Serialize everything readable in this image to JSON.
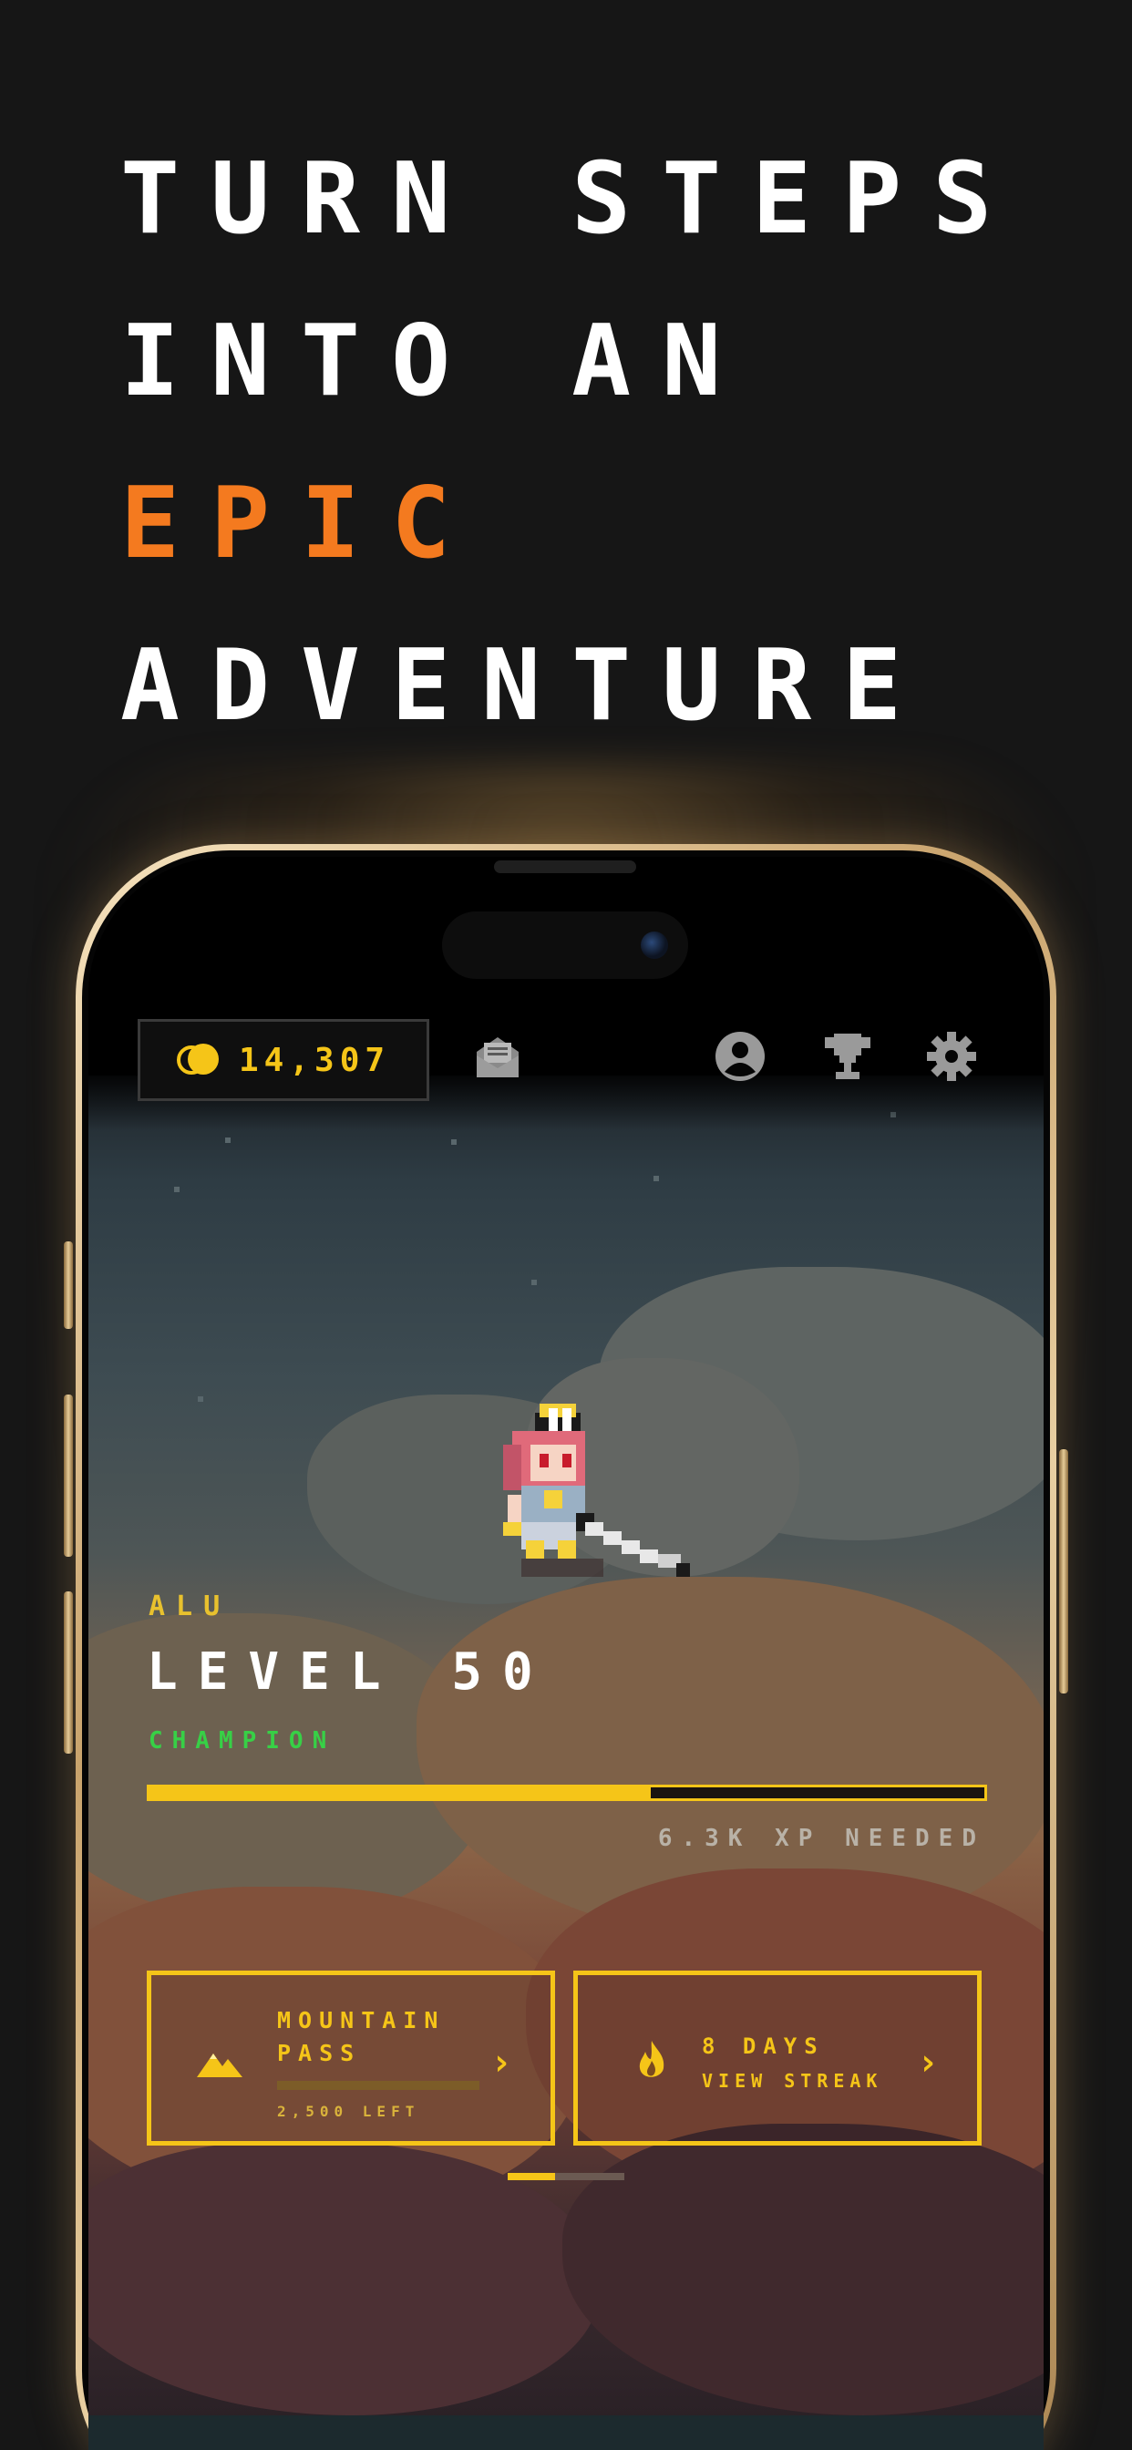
{
  "headline": {
    "line1": "TURN STEPS",
    "line2": "INTO AN",
    "line3": "EPIC",
    "line4": "ADVENTURE"
  },
  "colors": {
    "accent_orange": "#f47a1f",
    "coin_yellow": "#f5c518",
    "rank_green": "#37d046",
    "frame_gold": "#d9b17a"
  },
  "topbar": {
    "coin_balance": "14,307",
    "coin_icon": "coins-icon",
    "icons": [
      "mail-icon",
      "profile-icon",
      "trophy-icon",
      "settings-icon"
    ]
  },
  "player": {
    "name": "ALU",
    "level": "LEVEL 50",
    "title": "CHAMPION",
    "xp_progress": 0.6,
    "xp_needed": "6.3K XP NEEDED"
  },
  "cards": {
    "mountain": {
      "icon": "mountain-icon",
      "title": "MOUNTAIN PASS",
      "progress": 0.0,
      "remaining": "2,500 LEFT"
    },
    "streak": {
      "icon": "flame-icon",
      "days": "8 DAYS",
      "link": "VIEW STREAK"
    }
  },
  "pager": {
    "pages": 2,
    "active": 0
  }
}
